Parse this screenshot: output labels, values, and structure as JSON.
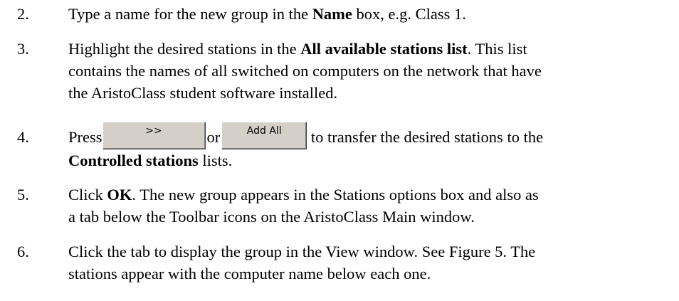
{
  "steps": [
    {
      "number": "2.",
      "pre": "Type a name for the new group in the ",
      "bold": "Name",
      "post": " box, e.g. Class 1."
    },
    {
      "number": "3.",
      "line1_pre": "Highlight the desired stations in the ",
      "line1_bold": "All available stations list",
      "line1_post": ". This list",
      "line2": "contains the names of all switched on computers on the network that have",
      "line3": "the AristoClass student software installed."
    },
    {
      "number": "4.",
      "press": "Press",
      "button_transfer_label": ">>",
      "or": "or",
      "button_add_all_label": "Add All",
      "line1_post": "to transfer the desired stations to the",
      "line2_bold": "Controlled stations",
      "line2_post": " lists."
    },
    {
      "number": "5.",
      "line1_pre": "Click ",
      "line1_bold": "OK",
      "line1_post": ". The new group appears in the Stations options box and also as",
      "line2": "a tab below the Toolbar icons on the AristoClass Main window."
    },
    {
      "number": "6.",
      "line1": "Click the tab to display the group in the View window. See Figure 5. The",
      "line2": "stations appear with the computer name below each one."
    }
  ]
}
